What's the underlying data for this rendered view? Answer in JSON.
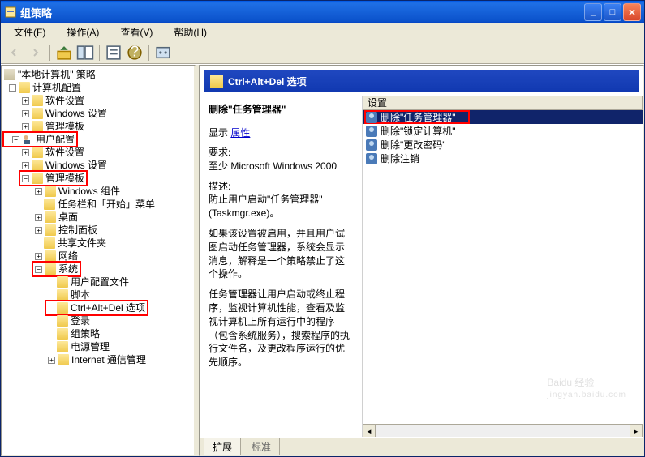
{
  "window": {
    "title": "组策略"
  },
  "menu": {
    "file": "文件(F)",
    "action": "操作(A)",
    "view": "查看(V)",
    "help": "帮助(H)"
  },
  "tree": {
    "root": "\"本地计算机\" 策略",
    "computer": "计算机配置",
    "soft1": "软件设置",
    "win1": "Windows 设置",
    "admin1": "管理模板",
    "user": "用户配置",
    "soft2": "软件设置",
    "win2": "Windows 设置",
    "admin2": "管理模板",
    "wincomp": "Windows 组件",
    "taskbar": "任务栏和「开始」菜单",
    "desktop": "桌面",
    "cpanel": "控制面板",
    "shared": "共享文件夹",
    "network": "网络",
    "system": "系统",
    "userprof": "用户配置文件",
    "script": "脚本",
    "cad": "Ctrl+Alt+Del 选项",
    "logon": "登录",
    "gpolicy": "组策略",
    "power": "电源管理",
    "inetcomm": "Internet 通信管理"
  },
  "header": {
    "title": "Ctrl+Alt+Del 选项"
  },
  "desc": {
    "heading": "删除\"任务管理器\"",
    "display_label": "显示",
    "display_link": "属性",
    "req_label": "要求:",
    "req_text": "至少 Microsoft Windows 2000",
    "ds_label": "描述:",
    "ds_line1": "防止用户启动\"任务管理器\"(Taskmgr.exe)。",
    "ds_p1": "如果该设置被启用，并且用户试图启动任务管理器，系统会显示消息，解释是一个策略禁止了这个操作。",
    "ds_p2": "任务管理器让用户启动或终止程序，监视计算机性能，查看及监视计算机上所有运行中的程序 （包含系统服务），搜索程序的执行文件名，及更改程序运行的优先顺序。"
  },
  "list": {
    "col": "设置",
    "items": [
      "删除\"任务管理器\"",
      "删除\"锁定计算机\"",
      "删除\"更改密码\"",
      "删除注销"
    ]
  },
  "tabs": {
    "extended": "扩展",
    "standard": "标准"
  },
  "watermark": {
    "brand": "Baidu 经验",
    "url": "jingyan.baidu.com"
  }
}
